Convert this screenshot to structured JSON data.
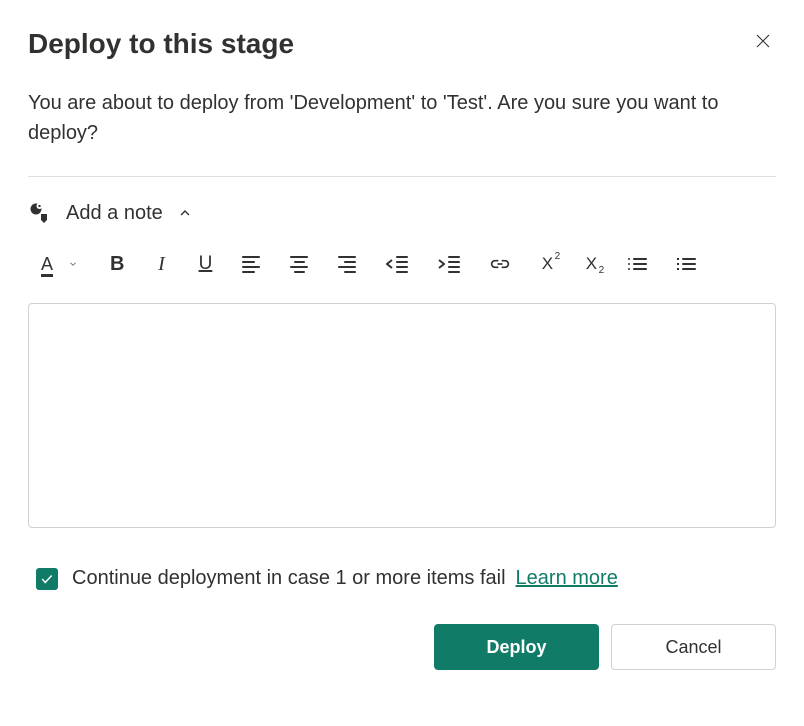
{
  "dialog": {
    "title": "Deploy to this stage",
    "description": "You are about to deploy from 'Development' to 'Test'. Are you sure you want to deploy?"
  },
  "note_section": {
    "title": "Add a note",
    "expanded": true,
    "value": ""
  },
  "toolbar": {
    "font_color": "A",
    "bold": "B",
    "italic": "I",
    "underline": "U",
    "superscript_base": "X",
    "superscript_mark": "2",
    "subscript_base": "X",
    "subscript_mark": "2"
  },
  "checkbox": {
    "checked": true,
    "label": "Continue deployment in case 1 or more items fail",
    "learn_more": "Learn more"
  },
  "buttons": {
    "primary": "Deploy",
    "secondary": "Cancel"
  },
  "colors": {
    "accent": "#107c67"
  }
}
